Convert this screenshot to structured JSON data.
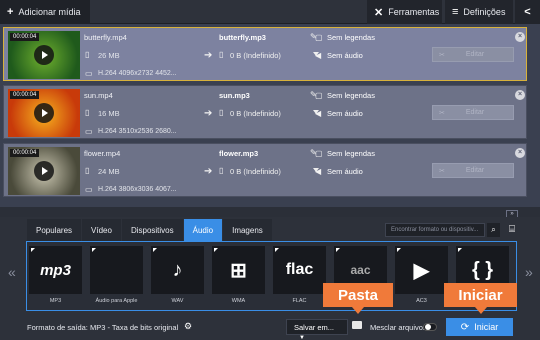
{
  "toolbar": {
    "add_label": "Adicionar mídia",
    "tools_label": "Ferramentas",
    "settings_label": "Definições"
  },
  "files": [
    {
      "duration": "00:00:04",
      "name": "butterfly.mp4",
      "size": "26 MB",
      "meta": "H.264 4096x2732 4452...",
      "output_name": "butterfly.mp3",
      "output_size": "0 B (Indefinido)",
      "subtitles": "Sem legendas",
      "audio": "Sem áudio",
      "edit": "Editar",
      "thumb_colors": [
        "#1f5a1c",
        "#6fb02e"
      ]
    },
    {
      "duration": "00:00:04",
      "name": "sun.mp4",
      "size": "16 MB",
      "meta": "H.264 3510x2536 2680...",
      "output_name": "sun.mp3",
      "output_size": "0 B (Indefinido)",
      "subtitles": "Sem legendas",
      "audio": "Sem áudio",
      "edit": "Editar",
      "thumb_colors": [
        "#c83a0a",
        "#f7b21f"
      ]
    },
    {
      "duration": "00:00:04",
      "name": "flower.mp4",
      "size": "24 MB",
      "meta": "H.264 3806x3036 4067...",
      "output_name": "flower.mp3",
      "output_size": "0 B (Indefinido)",
      "subtitles": "Sem legendas",
      "audio": "Sem áudio",
      "edit": "Editar",
      "thumb_colors": [
        "#4a4a3a",
        "#c9c5b0"
      ]
    }
  ],
  "tabs": [
    "Populares",
    "Vídeo",
    "Dispositivos",
    "Áudio",
    "Imagens"
  ],
  "active_tab": "Áudio",
  "search_placeholder": "Encontrar formato ou dispositiv...",
  "formats": [
    {
      "caption": "MP3",
      "glyph": "mp3"
    },
    {
      "caption": "Áudio para Apple",
      "glyph": ""
    },
    {
      "caption": "WAV",
      "glyph": "♪"
    },
    {
      "caption": "WMA",
      "glyph": "⊞"
    },
    {
      "caption": "FLAC",
      "glyph": "flac"
    },
    {
      "caption": "AAC",
      "glyph": "aac"
    },
    {
      "caption": "AC3",
      "glyph": "▶"
    },
    {
      "caption": "",
      "glyph": "{ }"
    }
  ],
  "bottom": {
    "output_format": "Formato de saída: MP3 - Taxa de bits original",
    "save_label": "Salvar em...",
    "merge_label": "Mesclar arquivos",
    "start_label": "Iniciar"
  },
  "callouts": {
    "folder": "Pasta",
    "start": "Iniciar"
  },
  "colors": {
    "accent": "#3a8ee6",
    "callout": "#f07a3a",
    "selected_border": "#d8b23b"
  }
}
